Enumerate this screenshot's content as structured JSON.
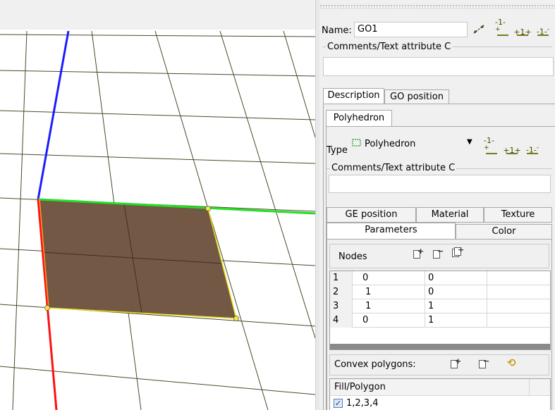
{
  "viewport": {
    "grid_color": "#4a4a2a",
    "axis_x_color": "#22e022",
    "axis_y_color": "#ff1010",
    "axis_z_color": "#1c1cff",
    "face_color": "#735845",
    "node_color": "#f5e83a"
  },
  "header": {
    "name_label": "Name:",
    "name_value": "GO1",
    "comments_label": "Comments/Text attribute C",
    "comments_value": ""
  },
  "tabs": [
    {
      "label": "Description"
    },
    {
      "label": "GO position"
    }
  ],
  "subtab": {
    "label": "Polyhedron"
  },
  "type": {
    "label": "Type",
    "selected": "Polyhedron",
    "comments_label": "Comments/Text attribute C",
    "comments_value": ""
  },
  "inner_tabs": {
    "row1": [
      {
        "label": "GE position"
      },
      {
        "label": "Material"
      },
      {
        "label": "Texture"
      }
    ],
    "row2": [
      {
        "label": "Parameters"
      },
      {
        "label": "Color"
      }
    ]
  },
  "nodes": {
    "label": "Nodes",
    "rows": [
      {
        "index": "1",
        "x": "0",
        "y": "0"
      },
      {
        "index": "2",
        "x": "1",
        "y": "0"
      },
      {
        "index": "3",
        "x": "1",
        "y": "1"
      },
      {
        "index": "4",
        "x": "0",
        "y": "1"
      }
    ]
  },
  "polygons": {
    "label": "Convex polygons:",
    "column": "Fill/Polygon",
    "rows": [
      {
        "value": "1,2,3,4",
        "checked": true
      }
    ]
  },
  "icons": {
    "name_toolbar": [
      "diagonal-icon",
      "add-layer-icon",
      "add-layers-icon",
      "remove-layer-icon"
    ],
    "type_toolbar": [
      "add-layer-icon",
      "add-layers-icon",
      "remove-layer-icon"
    ],
    "nodes_toolbar": [
      "add-node-icon",
      "remove-node-icon",
      "add-nodes-icon"
    ],
    "polygon_toolbar": [
      "add-polygon-icon",
      "remove-polygon-icon",
      "refresh-icon"
    ],
    "type_selected_icon": "polyhedron-icon"
  }
}
